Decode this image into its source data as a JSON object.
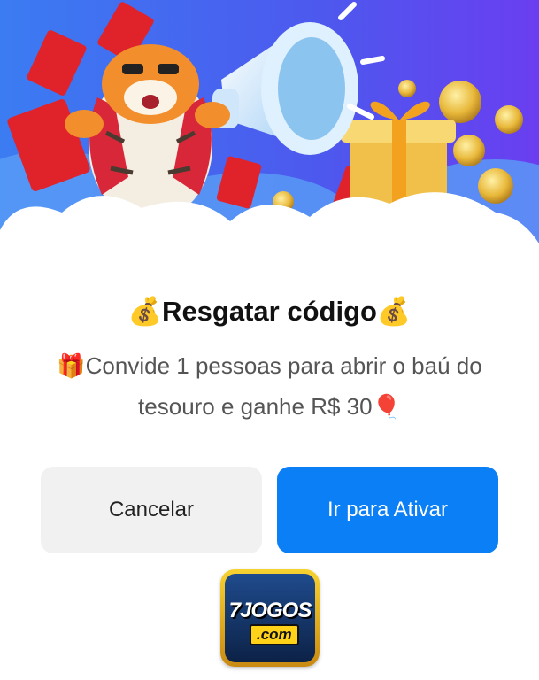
{
  "dialog": {
    "title": "💰Resgatar código💰",
    "message": "🎁Convide 1 pessoas para abrir o baú do tesouro e ganhe R$ 30🎈",
    "cancel_label": "Cancelar",
    "activate_label": "Ir para Ativar"
  },
  "logo": {
    "main_text": "7JOGOS",
    "sub_text": ".com"
  },
  "colors": {
    "primary_button": "#0a7ff6",
    "secondary_button": "#f1f1f1",
    "banner_sky": "#4a5ff0"
  },
  "icons": {
    "banner": [
      "tiger-mascot-illustration",
      "megaphone-icon",
      "gift-box-icon",
      "red-envelope-icon",
      "gold-coin-icon",
      "cloud-shape"
    ]
  }
}
